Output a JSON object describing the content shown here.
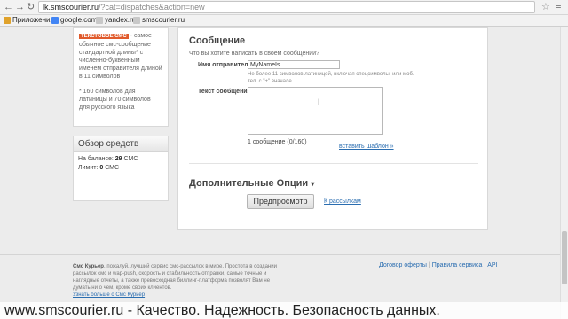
{
  "browser": {
    "url_host": "lk.smscourier.ru",
    "url_path": "/?cat=dispatches&action=new",
    "bookmarks": [
      {
        "label": "Приложения",
        "color": "#e0a22b"
      },
      {
        "label": "google.com",
        "color": "#4285f4"
      },
      {
        "label": "yandex.ru",
        "color": "#c0c0c0"
      },
      {
        "label": "smscourier.ru",
        "color": "#c0c0c0"
      }
    ]
  },
  "promo": {
    "badge": "ТЕКСТОВОЕ СМС",
    "text": " - самое обычное смс-сообщение стандартной длины* с численно-буквенным именем отправителя длиной в 11 символов",
    "note": "* 160 символов для латиницы и 70 символов для русского языка"
  },
  "funds": {
    "title": "Обзор средств",
    "balance_label": "На балансе:",
    "balance_value": "29",
    "limit_label": "Лимит:",
    "limit_value": "0",
    "currency": "СМС"
  },
  "form": {
    "heading": "Сообщение",
    "question": "Что вы хотите написать в своем сообщении?",
    "sender_label": "Имя отправителя",
    "sender_value": "MyNameIs",
    "sender_hint": "Не более 11 символов латиницей, включая спецсимволы, или моб. тел. с \"+\" вначале",
    "text_label": "Текст сообщения",
    "counter": "1 сообщение (0/160)",
    "template_link": "вставить шаблон »",
    "options_heading": "Дополнительные Опции",
    "options_arrow": "▾",
    "preview_button": "Предпросмотр",
    "back_link": "К рассылкам"
  },
  "footer": {
    "brand": "Смс Курьер",
    "text": ", пожалуй, лучший сервис смс-рассылок в мире. Простота в создании рассылок смс и wap-push, скорость и стабильность отправки, самые точные и наглядные отчеты, а также превосходная биллинг-платформа позволят Вам не думать ни о чем, кроме своих клиентов.",
    "more": "Узнать больше о Смс Курьер",
    "links": [
      "Договор оферты",
      "Правила сервиса",
      "API"
    ]
  },
  "overlay": "www.smscourier.ru - Качество. Надежность. Безопасность данных."
}
